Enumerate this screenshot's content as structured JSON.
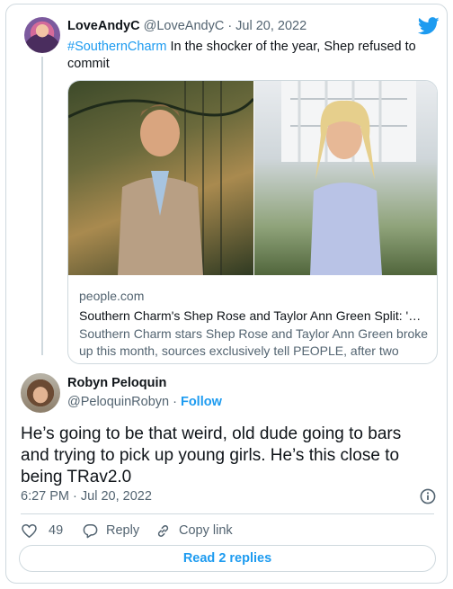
{
  "parent_tweet": {
    "name": "LoveAndyC",
    "handle_date": "@LoveAndyC · Jul 20, 2022",
    "hashtag": "#SouthernCharm",
    "text": " In the shocker of the year, Shep refused to commit",
    "link_card": {
      "domain": "people.com",
      "title": "Southern Charm's Shep Rose and Taylor Ann Green Split: 'He ...",
      "description": "Southern Charm stars Shep Rose and Taylor Ann Green broke up this month, sources exclusively tell PEOPLE, after two year..."
    }
  },
  "main_tweet": {
    "name": "Robyn Peloquin",
    "handle": "@PeloquinRobyn",
    "separator": " · ",
    "follow_label": "Follow",
    "text": "He’s going to be that weird, old dude going to bars and trying to pick up young girls. He’s this close to being TRav2.0",
    "timestamp": "6:27 PM · Jul 20, 2022",
    "actions": {
      "like_count": "49",
      "reply_label": "Reply",
      "copy_link_label": "Copy link"
    },
    "read_replies_label": "Read 2 replies"
  },
  "icons": {
    "brand": "twitter-bird-icon",
    "like": "heart-icon",
    "reply": "speech-bubble-icon",
    "copy": "link-icon",
    "info": "info-icon"
  },
  "colors": {
    "accent": "#1d9bf0",
    "text": "#0f1419",
    "secondary": "#536471",
    "border": "#cfd9de"
  }
}
